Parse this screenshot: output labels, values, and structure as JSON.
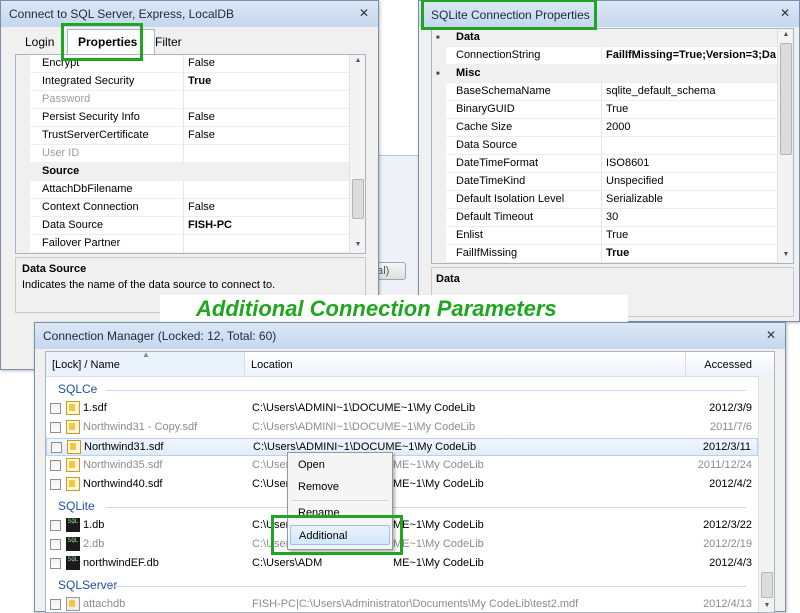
{
  "sql_window": {
    "title": "Connect to SQL Server, Express, LocalDB",
    "close": "✕",
    "tabs": [
      "Login",
      "Properties",
      "Filter"
    ],
    "rows": [
      {
        "name": "Encrypt",
        "value": "False",
        "kind": "prop"
      },
      {
        "name": "Integrated Security",
        "value": "True",
        "kind": "bold"
      },
      {
        "name": "Password",
        "value": "",
        "kind": "disabled"
      },
      {
        "name": "Persist Security Info",
        "value": "False",
        "kind": "prop"
      },
      {
        "name": "TrustServerCertificate",
        "value": "False",
        "kind": "prop"
      },
      {
        "name": "User ID",
        "value": "",
        "kind": "disabled"
      },
      {
        "name": "Source",
        "value": "",
        "kind": "cat"
      },
      {
        "name": "AttachDbFilename",
        "value": "",
        "kind": "prop"
      },
      {
        "name": "Context Connection",
        "value": "False",
        "kind": "prop"
      },
      {
        "name": "Data Source",
        "value": "FISH-PC",
        "kind": "bold"
      },
      {
        "name": "Failover Partner",
        "value": "",
        "kind": "prop"
      }
    ],
    "desc_title": "Data Source",
    "desc_text": "Indicates the name of the data source to connect to.",
    "partial_button": "bal)"
  },
  "sqlite_window": {
    "title": "SQLite Connection Properties",
    "close": "✕",
    "rows": [
      {
        "name": "Data",
        "value": "",
        "kind": "cat"
      },
      {
        "name": "ConnectionString",
        "value": "FailIfMissing=True;Version=3;Da",
        "kind": "bold"
      },
      {
        "name": "Misc",
        "value": "",
        "kind": "cat"
      },
      {
        "name": "BaseSchemaName",
        "value": "sqlite_default_schema",
        "kind": "prop"
      },
      {
        "name": "BinaryGUID",
        "value": "True",
        "kind": "prop"
      },
      {
        "name": "Cache Size",
        "value": "2000",
        "kind": "prop"
      },
      {
        "name": "Data Source",
        "value": "",
        "kind": "prop"
      },
      {
        "name": "DateTimeFormat",
        "value": "ISO8601",
        "kind": "prop"
      },
      {
        "name": "DateTimeKind",
        "value": "Unspecified",
        "kind": "prop"
      },
      {
        "name": "Default Isolation Level",
        "value": "Serializable",
        "kind": "prop"
      },
      {
        "name": "Default Timeout",
        "value": "30",
        "kind": "prop"
      },
      {
        "name": "Enlist",
        "value": "True",
        "kind": "prop"
      },
      {
        "name": "FailIfMissing",
        "value": "True",
        "kind": "bold"
      }
    ],
    "desc_title": "Data"
  },
  "caption": "Additional Connection Parameters",
  "conn_manager": {
    "title": "Connection Manager (Locked: 12, Total: 60)",
    "close": "✕",
    "columns": {
      "name": "[Lock] / Name",
      "location": "Location",
      "accessed": "Accessed"
    },
    "groups": [
      {
        "label": "SQLCe",
        "items": [
          {
            "name": "1.sdf",
            "location": "C:\\Users\\ADMINI~1\\DOCUME~1\\My CodeLib",
            "accessed": "2012/3/9",
            "grey": false,
            "icon": "sdf-file-icon"
          },
          {
            "name": "Northwind31 - Copy.sdf",
            "location": "C:\\Users\\ADMINI~1\\DOCUME~1\\My CodeLib",
            "accessed": "2011/7/6",
            "grey": true,
            "icon": "sdf-file-icon"
          },
          {
            "name": "Northwind31.sdf",
            "location": "C:\\Users\\ADMINI~1\\DOCUME~1\\My CodeLib",
            "accessed": "2012/3/11",
            "grey": false,
            "icon": "sdf-file-icon",
            "selected": true
          },
          {
            "name": "Northwind35.sdf",
            "location": "C:\\Users\\ADMINI~1\\DOCU",
            "accessed": "2011/12/24",
            "grey": true,
            "icon": "sdf-file-icon",
            "loc_tail": "ME~1\\My CodeLib"
          },
          {
            "name": "Northwind40.sdf",
            "location": "C:\\Users\\ADMINI~1\\DOCU",
            "accessed": "2012/4/2",
            "grey": false,
            "icon": "sdf-file-icon",
            "loc_tail": "ME~1\\My CodeLib"
          }
        ]
      },
      {
        "label": "SQLite",
        "items": [
          {
            "name": "1.db",
            "location": "C:\\Users\\ADM",
            "accessed": "2012/3/22",
            "grey": false,
            "icon": "sqlite-db-icon",
            "loc_tail": "ME~1\\My CodeLib"
          },
          {
            "name": "2.db",
            "location": "C:\\Users\\ADM",
            "accessed": "2012/2/19",
            "grey": true,
            "icon": "sqlite-db-icon",
            "loc_tail": "ME~1\\My CodeLib"
          },
          {
            "name": "northwindEF.db",
            "location": "C:\\Users\\ADM",
            "accessed": "2012/4/3",
            "grey": false,
            "icon": "sqlite-db-icon",
            "loc_tail": "ME~1\\My CodeLib"
          }
        ]
      },
      {
        "label": "SQLServer",
        "items": [
          {
            "name": "attachdb",
            "location": "FISH-PC|C:\\Users\\Administrator\\Documents\\My CodeLib\\test2.mdf",
            "accessed": "2012/4/13",
            "grey": true,
            "icon": "db-file-icon"
          }
        ]
      }
    ],
    "context_menu": [
      "Open",
      "Remove",
      "Rename",
      "Additional"
    ]
  }
}
